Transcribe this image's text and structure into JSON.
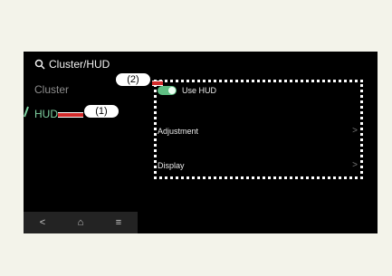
{
  "search": {
    "label": "Cluster/HUD"
  },
  "nav": {
    "items": [
      {
        "label": "Cluster"
      },
      {
        "label": "HUD"
      }
    ]
  },
  "panel": {
    "toggle_label": "Use HUD",
    "rows": [
      {
        "label": "Adjustment",
        "chevron": ">"
      },
      {
        "label": "Display",
        "chevron": ">"
      }
    ]
  },
  "bottom_nav": {
    "back": "<",
    "home": "⌂",
    "menu": "≡"
  },
  "callouts": {
    "one": "(1)",
    "two": "(2)"
  },
  "colors": {
    "active": "#7fd1a1",
    "toggle_on": "#5fbf83",
    "callout_line": "#d32b2b"
  }
}
